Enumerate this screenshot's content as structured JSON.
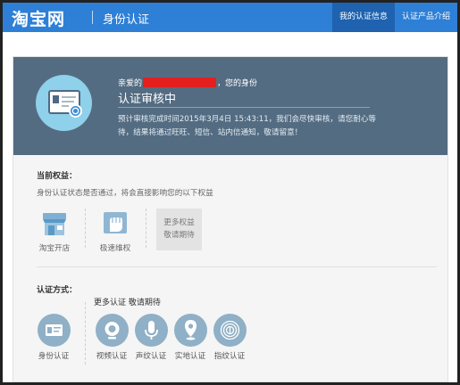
{
  "header": {
    "logo": "淘宝网",
    "title": "身份认证",
    "nav": [
      "我的认证信息",
      "认证产品介绍"
    ]
  },
  "banner": {
    "greeting_prefix": "亲爱的",
    "greeting_suffix": "，您的身份",
    "status": "认证审核中",
    "notice": "预计审核完成时间2015年3月4日 15:43:11，我们会尽快审核，请您耐心等待，结果将通过旺旺、短信、站内信通知，敬请留意！"
  },
  "benefits": {
    "title": "当前权益：",
    "desc": "身份认证状态是否通过，将会直接影响您的以下权益",
    "items": [
      {
        "label": "淘宝开店",
        "icon": "shop-icon"
      },
      {
        "label": "极速维权",
        "icon": "fist-icon"
      }
    ],
    "more": [
      "更多权益",
      "敬请期待"
    ]
  },
  "verify": {
    "title": "认证方式：",
    "current": {
      "label": "身份认证",
      "icon": "id-card-icon"
    },
    "more_title": "更多认证 敬请期待",
    "items": [
      {
        "label": "视频认证",
        "icon": "camera-icon"
      },
      {
        "label": "声纹认证",
        "icon": "microphone-icon"
      },
      {
        "label": "实地认证",
        "icon": "location-pin-icon"
      },
      {
        "label": "指纹认证",
        "icon": "fingerprint-icon"
      }
    ]
  },
  "colors": {
    "header_blue": "#2e7fd6",
    "banner_slate": "#546c82",
    "accent_light_blue": "#8fd0ea",
    "redaction_red": "#e4201f"
  }
}
